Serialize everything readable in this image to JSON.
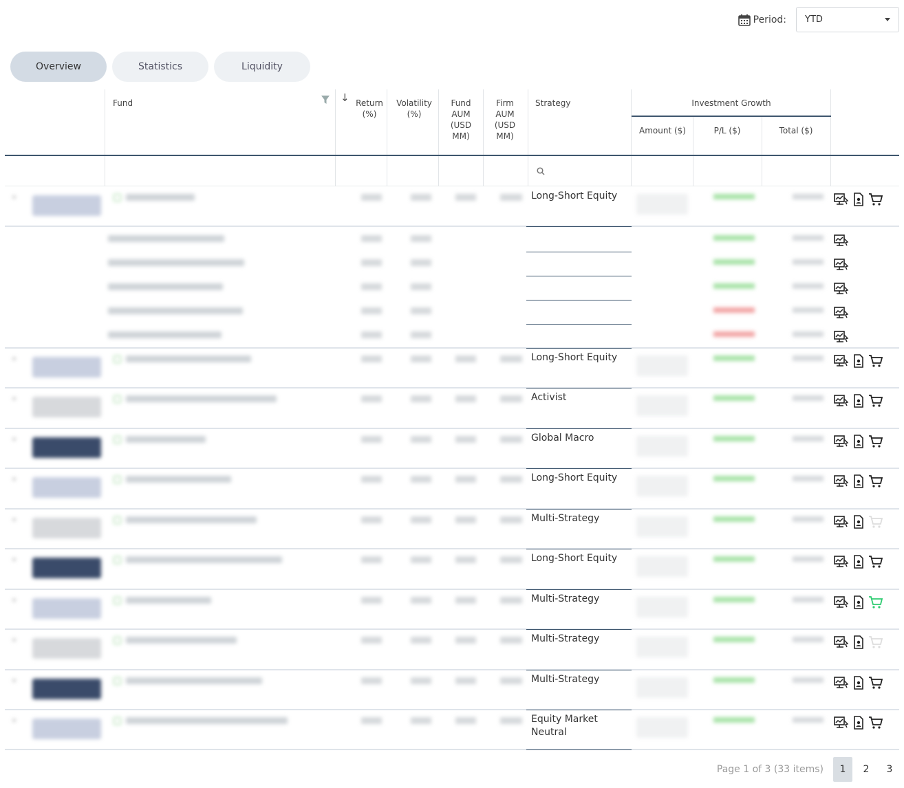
{
  "header": {
    "period_label": "Period:",
    "period_value": "YTD"
  },
  "tabs": [
    {
      "label": "Overview"
    },
    {
      "label": "Statistics"
    },
    {
      "label": "Liquidity"
    }
  ],
  "columns": {
    "fund": "Fund",
    "return": "Return (%)",
    "volatility": "Volatility (%)",
    "fund_aum": "Fund AUM (USD MM)",
    "firm_aum": "Firm AUM (USD MM)",
    "strategy": "Strategy",
    "investment_growth": "Investment Growth",
    "amount": "Amount ($)",
    "pl": "P/L ($)",
    "total": "Total ($)"
  },
  "rows": [
    {
      "strategy": "Long-Short Equity",
      "type": "fund"
    },
    {
      "strategy": "",
      "type": "index"
    },
    {
      "strategy": "",
      "type": "index"
    },
    {
      "strategy": "",
      "type": "index"
    },
    {
      "strategy": "",
      "type": "index",
      "neg": true
    },
    {
      "strategy": "",
      "type": "index",
      "neg": true
    },
    {
      "strategy": "Long-Short Equity",
      "type": "fund"
    },
    {
      "strategy": "Activist",
      "type": "fund"
    },
    {
      "strategy": "Global Macro",
      "type": "fund"
    },
    {
      "strategy": "Long-Short Equity",
      "type": "fund"
    },
    {
      "strategy": "Multi-Strategy",
      "type": "fund",
      "cart": "disabled"
    },
    {
      "strategy": "Long-Short Equity",
      "type": "fund"
    },
    {
      "strategy": "Multi-Strategy",
      "type": "fund",
      "cart": "active"
    },
    {
      "strategy": "Multi-Strategy",
      "type": "fund",
      "cart": "disabled"
    },
    {
      "strategy": "Multi-Strategy",
      "type": "fund"
    },
    {
      "strategy": "Equity Market Neutral",
      "type": "fund"
    }
  ],
  "pager": {
    "info": "Page 1 of 3 (33 items)",
    "pages": [
      "1",
      "2",
      "3"
    ]
  },
  "colors": {
    "accent": "#3e566e",
    "positive": "#66cc66",
    "negative": "#ee5555",
    "cart_active": "#2ecc71"
  }
}
